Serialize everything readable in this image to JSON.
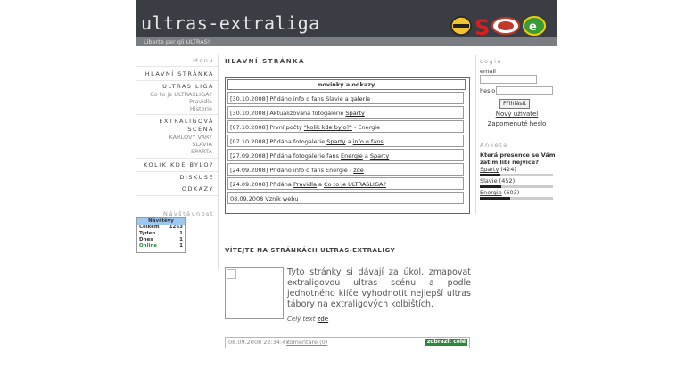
{
  "header": {
    "title": "ultras-extraliga",
    "tagline": "Liberte per gli ULTRAS!"
  },
  "menu": {
    "title": "Menu",
    "items": [
      {
        "label": "HLAVNÍ STRÁNKA"
      },
      {
        "label": "ULTRAS LIGA",
        "subs": [
          "Co to je ULTRASLIGA?",
          "Pravidla",
          "Historie"
        ]
      },
      {
        "label": "EXTRALIGOVÁ SCÉNA",
        "subs": [
          "KARLOVY VARY",
          "SLAVIA",
          "SPARTA"
        ]
      },
      {
        "label": "KOLIK KDE BYLO?"
      },
      {
        "label": "DISKUSE"
      },
      {
        "label": "ODKAZY"
      }
    ]
  },
  "visits": {
    "title": "Návštěvnost",
    "head": "Návštěvy",
    "rows": [
      {
        "label": "Celkem",
        "value": "1263"
      },
      {
        "label": "Týden",
        "value": "1"
      },
      {
        "label": "Dnes",
        "value": "1"
      },
      {
        "label": "Online",
        "value": "1"
      }
    ]
  },
  "main": {
    "title": "HLAVNÍ STRÁNKA",
    "news_head": "novinky a odkazy",
    "news": [
      {
        "date": "[30.10.2008]",
        "text": " Přidáno ",
        "link1": "info",
        "mid": " o fans Slavie a ",
        "link2": "galerie",
        "tail": ""
      },
      {
        "date": "[30.10.2008]",
        "text": " Aktualizována fotogalerie ",
        "link1": "Sparty",
        "mid": "",
        "link2": "",
        "tail": ""
      },
      {
        "date": "[07.10.2008]",
        "text": " První počty ",
        "link1": "\"kolik kde bylo?\"",
        "mid": " - Energie",
        "link2": "",
        "tail": ""
      },
      {
        "date": "[07.10.2008]",
        "text": " Přidána fotogalerie ",
        "link1": "Sparty",
        "mid": " a ",
        "link2": "info o fans",
        "tail": ""
      },
      {
        "date": "[27.09.2008]",
        "text": " Přidána fotogalerie fans ",
        "link1": "Energie",
        "mid": " a ",
        "link2": "Sparty",
        "tail": ""
      },
      {
        "date": "[24.09.2008]",
        "text": " Přidáno info o fans Energie - ",
        "link1": "zde",
        "mid": "",
        "link2": "",
        "tail": ""
      },
      {
        "date": "[24.09.2008]",
        "text": " Přidána ",
        "link1": "Pravidla",
        "mid": " a ",
        "link2": "Co to je ULTRASLIGA?",
        "tail": ""
      },
      {
        "date": "08.09.2008",
        "text": " Vznik webu",
        "link1": "",
        "mid": "",
        "link2": "",
        "tail": ""
      }
    ],
    "welcome": "VÍTEJTE NA STRÁNKÁCH ULTRAS-EXTRALIGY",
    "article_text": "Tyto stránky si dávají za úkol, zmapovat extraligovou ultras scénu a podle jednotného klíče vyhodnotit nejlepší ultras tábory na extraligových kolbištích.",
    "article_more": "Celý text ",
    "article_more_link": "zde",
    "post_date": "08.09.2008 22:34:47",
    "post_comments": "komentáře (0)",
    "show_all": "zobrazit celé"
  },
  "login": {
    "title": "Login",
    "email_label": "email",
    "password_label": "heslo",
    "button": "Přihlásit",
    "new_user": "Nový uživatel",
    "forgot": "Zapomenuté heslo"
  },
  "poll": {
    "title": "Anketa",
    "question": "Která presence se Vám zatím líbí nejvíce?",
    "options": [
      {
        "name": "Sparty",
        "count": "(424)",
        "share": 0.28
      },
      {
        "name": "Slavie",
        "count": "(452)",
        "share": 0.3
      },
      {
        "name": "Energie",
        "count": "(603)",
        "share": 0.42
      }
    ]
  },
  "colors": {
    "header_bg": "#3a3e44",
    "tagline_bg": "#7a7e83",
    "visits_head": "#9ec8f0",
    "show_all_bg": "#2a8a3a"
  },
  "icons": [
    "club-logo-yellow-icon",
    "club-logo-s-icon",
    "club-logo-red-icon",
    "club-logo-e-icon"
  ]
}
